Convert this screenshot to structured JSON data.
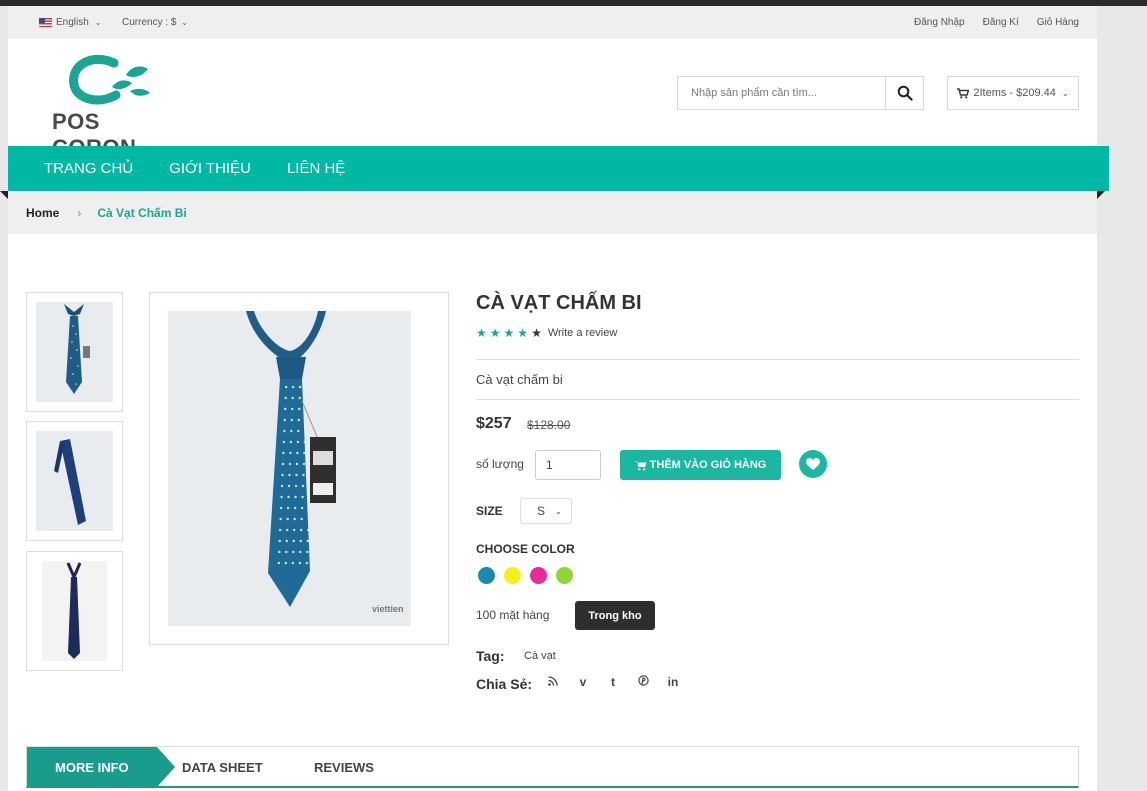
{
  "topbar": {
    "language": "English",
    "currency": "Currency : $",
    "links": [
      "Đăng Nhập",
      "Đăng Kí",
      "Giỏ Hàng"
    ]
  },
  "header": {
    "logo_text": "POS CORON",
    "search_placeholder": "Nhập sản phẩm cần tìm...",
    "cart_summary": "2Items - $209.44"
  },
  "nav": {
    "items": [
      "TRANG CHỦ",
      "GIỚI THIỆU",
      "LIÊN HỆ"
    ]
  },
  "breadcrumb": {
    "home": "Home",
    "separator": "›",
    "current": "Cà Vạt Chấm Bi"
  },
  "product": {
    "title": "CÀ VẠT CHẤM BI",
    "rating": 4,
    "rating_max": 5,
    "review_link": "Write a review",
    "short_description": "Cà vạt chấm bi",
    "price": "$257",
    "old_price": "$128.00",
    "quantity_label": "số lượng",
    "quantity_value": "1",
    "add_to_cart_label": "THÊM VÀO GIỎ HÀNG",
    "size_label": "SIZE",
    "size_value": "S",
    "color_label": "CHOOSE COLOR",
    "colors": [
      "#1a8ab5",
      "#f2f21a",
      "#e92a9a",
      "#8fd634"
    ],
    "stock_text": "100 mặt hàng",
    "stock_status": "Trong kho",
    "tag_label": "Tag:",
    "tag_value": "Cà vạt",
    "share_label": "Chia Sẻ:",
    "share_icons": [
      "rss-icon",
      "vimeo-icon",
      "tumblr-icon",
      "pinterest-icon",
      "linkedin-icon"
    ],
    "main_image_brand": "viettien"
  },
  "tabs": {
    "items": [
      "MORE INFO",
      "DATA SHEET",
      "REVIEWS"
    ],
    "active": "MORE INFO"
  },
  "colors": {
    "accent": "#00b8a3",
    "accent_dark": "#1a9c8c"
  }
}
